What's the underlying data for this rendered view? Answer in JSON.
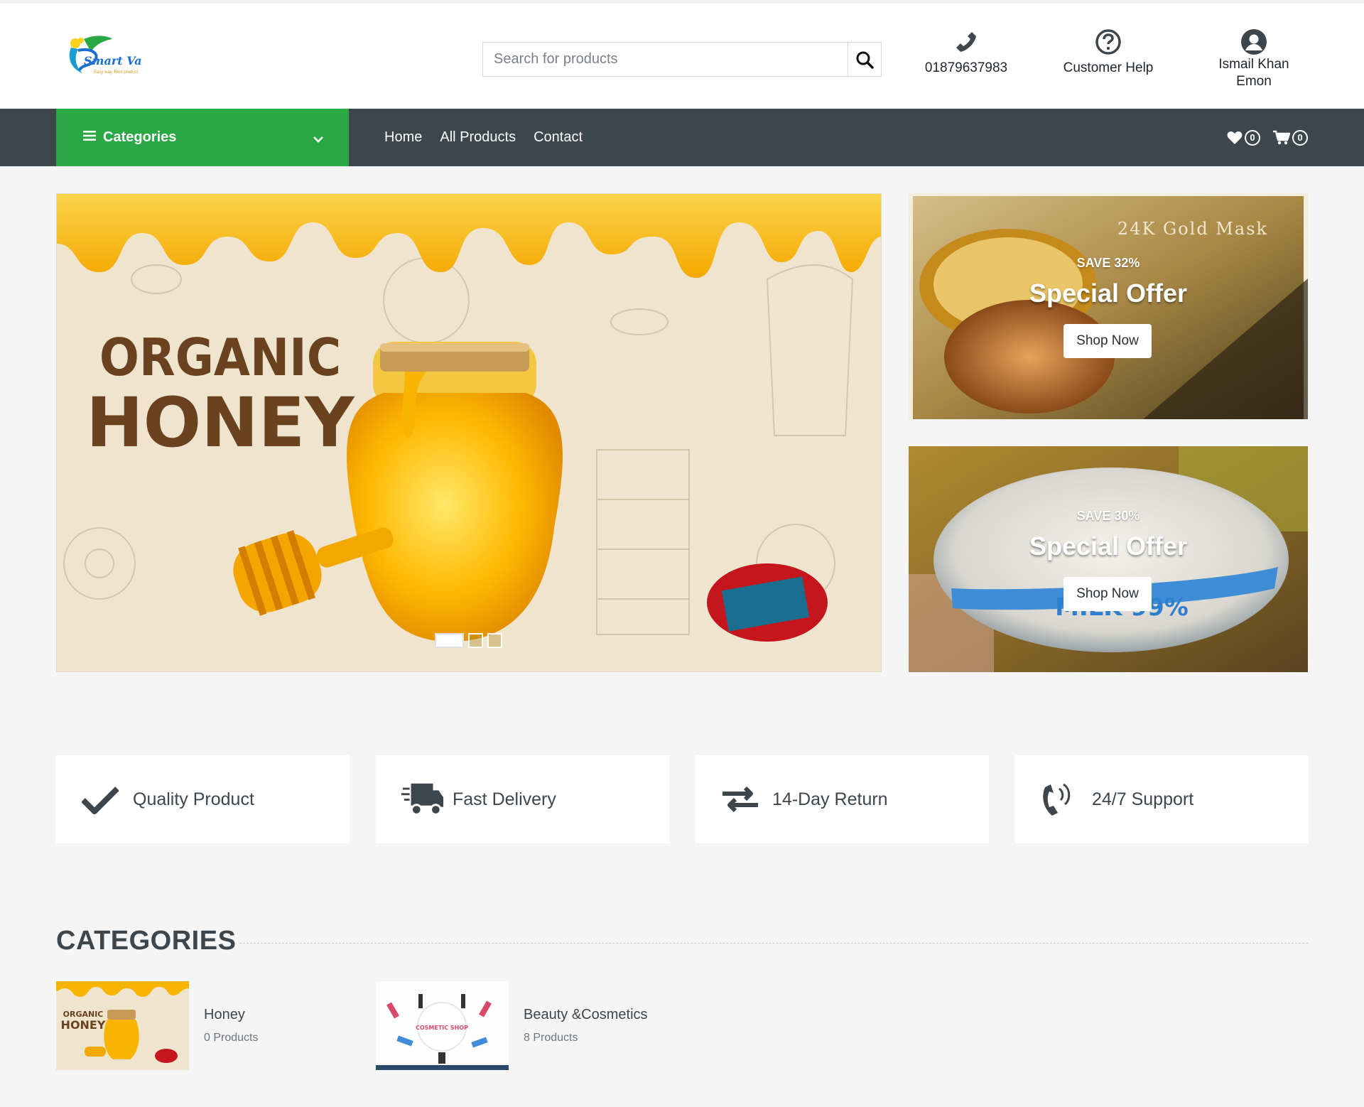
{
  "brand": {
    "name": "Smart Valy",
    "tagline": "Easy way, Best product"
  },
  "search": {
    "placeholder": "Search for products"
  },
  "header": {
    "phone": "01879637983",
    "help": "Customer Help",
    "user": "Ismail Khan Emon"
  },
  "nav": {
    "categories_label": "Categories",
    "links": [
      "Home",
      "All Products",
      "Contact"
    ],
    "wishlist_count": "0",
    "cart_count": "0"
  },
  "hero": {
    "line1": "ORGANIC",
    "line2": "HONEY",
    "slides": 3,
    "active_slide": 1
  },
  "offers": [
    {
      "save": "SAVE 32%",
      "title": "Special Offer",
      "button": "Shop Now",
      "product_text": "24K Gold Mask"
    },
    {
      "save": "SAVE 30%",
      "title": "Special Offer",
      "button": "Shop Now",
      "product_text": "MILK 99%"
    }
  ],
  "features": [
    "Quality Product",
    "Fast Delivery",
    "14-Day Return",
    "24/7 Support"
  ],
  "categories_section": {
    "title": "CATEGORIES",
    "items": [
      {
        "name": "Honey",
        "count": "0 Products",
        "thumb_line1": "ORGANIC",
        "thumb_line2": "HONEY"
      },
      {
        "name": "Beauty &Cosmetics",
        "count": "8 Products",
        "thumb_text": "COSMETIC SHOP"
      }
    ]
  },
  "colors": {
    "nav_bg": "#3d464d",
    "category_green": "#2aa844",
    "page_bg": "#f5f5f5",
    "honey": "#f7b500"
  }
}
